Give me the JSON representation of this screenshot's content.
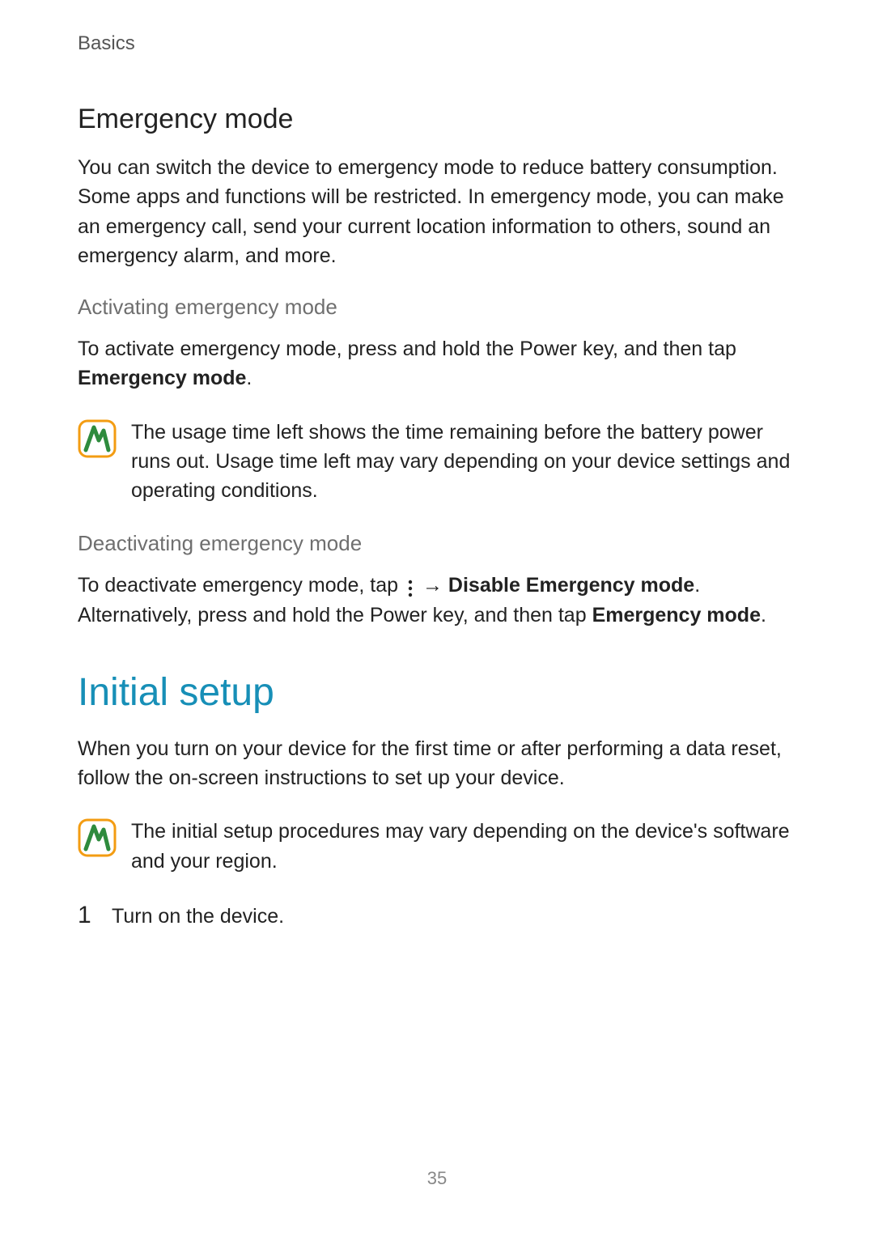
{
  "chapter": "Basics",
  "emergency": {
    "title": "Emergency mode",
    "intro": "You can switch the device to emergency mode to reduce battery consumption. Some apps and functions will be restricted. In emergency mode, you can make an emergency call, send your current location information to others, sound an emergency alarm, and more.",
    "activate": {
      "heading": "Activating emergency mode",
      "text_before": "To activate emergency mode, press and hold the Power key, and then tap ",
      "action": "Emergency mode",
      "text_after": ".",
      "note": "The usage time left shows the time remaining before the battery power runs out. Usage time left may vary depending on your device settings and operating conditions."
    },
    "deactivate": {
      "heading": "Deactivating emergency mode",
      "seg1": "To deactivate emergency mode, tap ",
      "seg2": " → ",
      "action1": "Disable Emergency mode",
      "seg3": ". Alternatively, press and hold the Power key, and then tap ",
      "action2": "Emergency mode",
      "seg4": "."
    }
  },
  "initial_setup": {
    "title": "Initial setup",
    "intro": "When you turn on your device for the first time or after performing a data reset, follow the on-screen instructions to set up your device.",
    "note": "The initial setup procedures may vary depending on the device's software and your region.",
    "steps": [
      {
        "num": "1",
        "text": "Turn on the device."
      }
    ]
  },
  "page_number": "35",
  "colors": {
    "accent": "#178fb7",
    "note_border": "#f39c12",
    "note_fill": "#2e8b3d"
  }
}
